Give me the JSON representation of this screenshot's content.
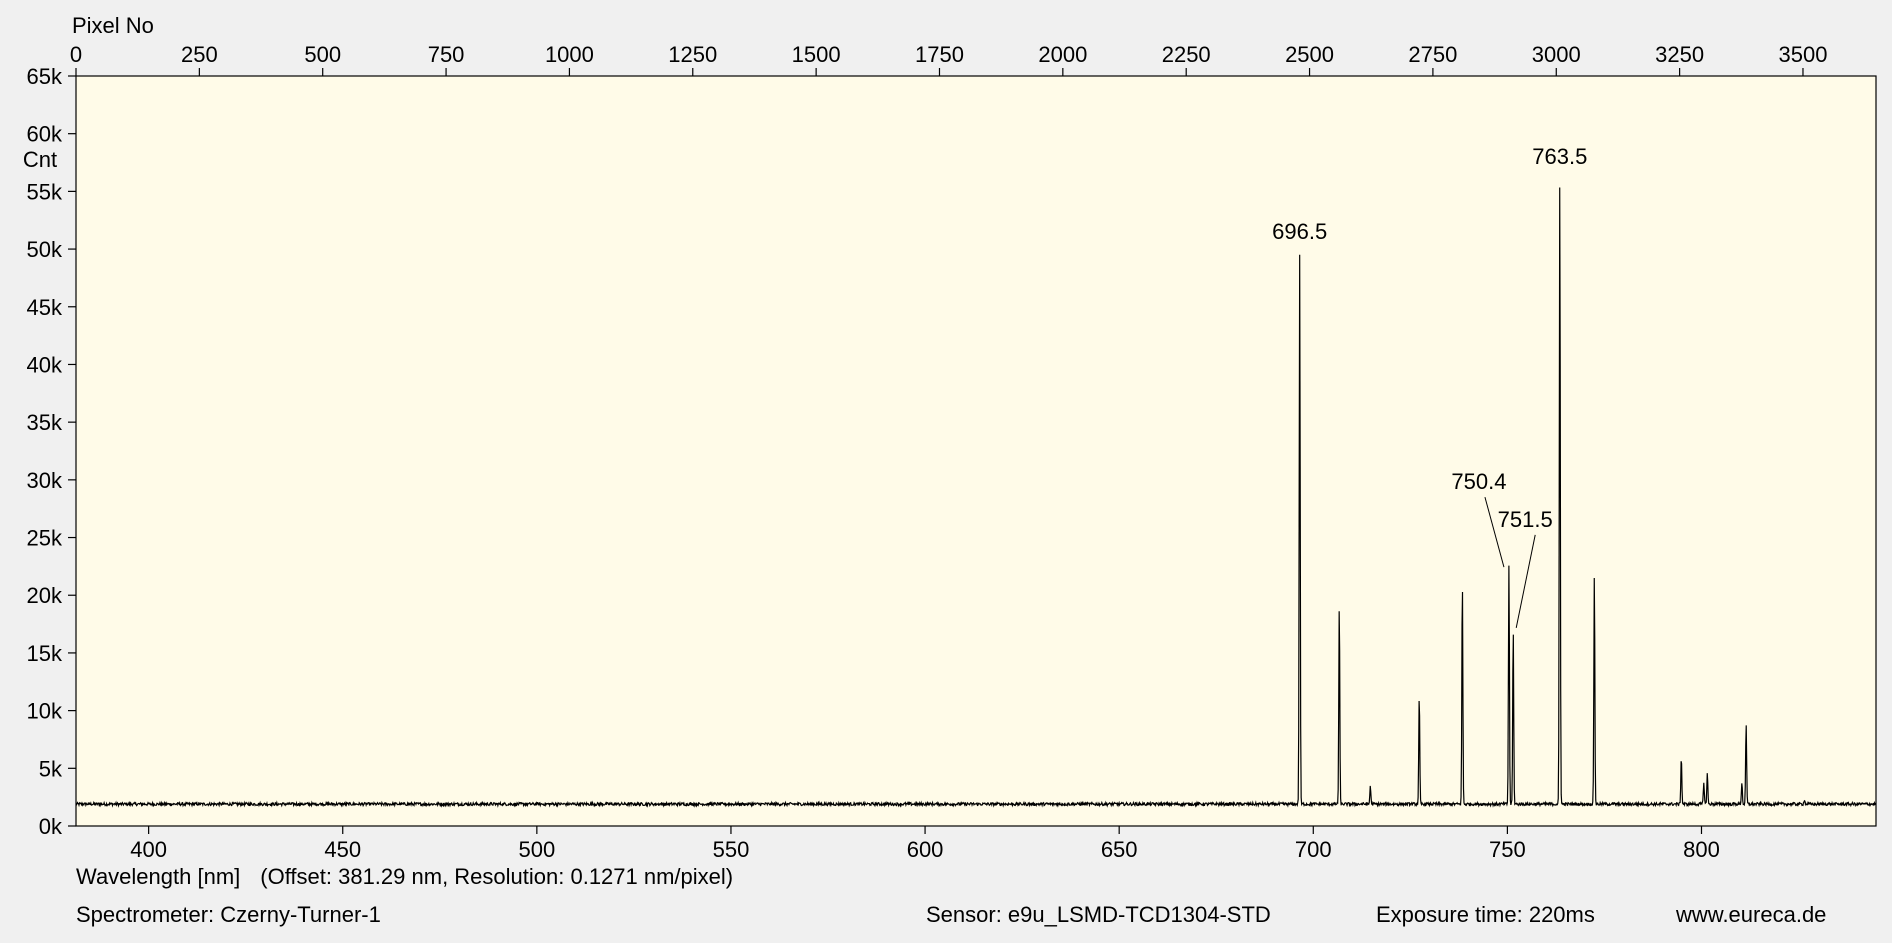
{
  "chart_data": {
    "type": "line",
    "top_axis": {
      "label": "Pixel No",
      "ticks": [
        0,
        250,
        500,
        750,
        1000,
        1250,
        1500,
        1750,
        2000,
        2250,
        2500,
        2750,
        3000,
        3250,
        3500
      ],
      "tick_labels": [
        "0",
        "250",
        "500",
        "750",
        "1000",
        "1250",
        "1500",
        "1750",
        "2000",
        "2250",
        "2500",
        "2750",
        "3000",
        "3250",
        "3500"
      ]
    },
    "x_axis": {
      "label": "Wavelength [nm]",
      "note": "(Offset: 381.29 nm, Resolution: 0.1271 nm/pixel)",
      "ticks": [
        400,
        450,
        500,
        550,
        600,
        650,
        700,
        750,
        800
      ],
      "tick_labels": [
        "400",
        "450",
        "500",
        "550",
        "600",
        "650",
        "700",
        "750",
        "800"
      ],
      "offset_nm": 381.29,
      "resolution_nm_per_pixel": 0.1271
    },
    "y_axis": {
      "label": "Cnt",
      "ylim": [
        0,
        65000
      ],
      "ticks": [
        0,
        5000,
        10000,
        15000,
        20000,
        25000,
        30000,
        35000,
        40000,
        45000,
        50000,
        55000,
        60000,
        65000
      ],
      "tick_labels": [
        "0k",
        "5k",
        "10k",
        "15k",
        "20k",
        "25k",
        "30k",
        "35k",
        "40k",
        "45k",
        "50k",
        "55k",
        "60k",
        "65k"
      ]
    },
    "xlim_pixel": [
      0,
      3648
    ],
    "baseline": 1900,
    "series": [
      {
        "color": "#000000",
        "peaks": [
          {
            "x": 696.5,
            "y": 49500
          },
          {
            "x": 706.7,
            "y": 19200
          },
          {
            "x": 714.7,
            "y": 3500
          },
          {
            "x": 727.3,
            "y": 11300
          },
          {
            "x": 738.4,
            "y": 21300
          },
          {
            "x": 750.4,
            "y": 22700
          },
          {
            "x": 751.5,
            "y": 17000
          },
          {
            "x": 763.5,
            "y": 56000
          },
          {
            "x": 772.4,
            "y": 21900
          },
          {
            "x": 794.8,
            "y": 6000
          },
          {
            "x": 800.6,
            "y": 3800
          },
          {
            "x": 801.5,
            "y": 4600
          },
          {
            "x": 810.4,
            "y": 3800
          },
          {
            "x": 811.5,
            "y": 8800
          },
          {
            "x": 826.5,
            "y": 2300
          }
        ]
      }
    ],
    "annotations": [
      {
        "text": "696.5",
        "x": 696.5,
        "y": 49500,
        "leader": false
      },
      {
        "text": "750.4",
        "x": 750.4,
        "y": 22700,
        "leader": true
      },
      {
        "text": "751.5",
        "x": 751.5,
        "y": 17000,
        "leader": true
      },
      {
        "text": "763.5",
        "x": 763.5,
        "y": 56000,
        "leader": false
      }
    ],
    "colors": {
      "plot_bg": "#fffbe8",
      "page_bg": "#f0f0f0",
      "line": "#000000"
    }
  },
  "footer": {
    "spectrometer": "Spectrometer: Czerny-Turner-1",
    "sensor": "Sensor: e9u_LSMD-TCD1304-STD",
    "exposure": "Exposure time: 220ms",
    "website": "www.eureca.de"
  }
}
